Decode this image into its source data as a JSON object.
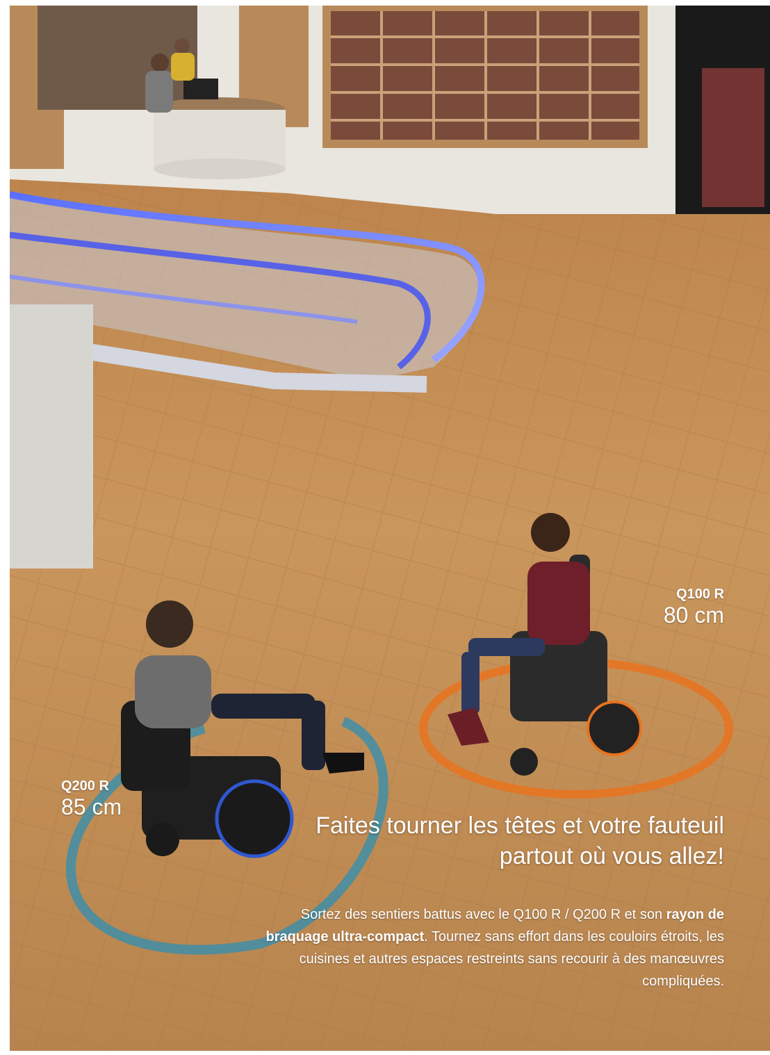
{
  "labels": {
    "q100_model": "Q100 R",
    "q100_distance": "80 cm",
    "q200_model": "Q200 R",
    "q200_distance": "85 cm"
  },
  "headline": {
    "line1": "Faites tourner les têtes et votre fauteuil",
    "line2": "partout où vous allez!"
  },
  "body": {
    "part1": "Sortez des sentiers battus avec le Q100 R / Q200 R et son",
    "emphasis": "rayon de braquage ultra-compact",
    "part2": ". Tournez sans effort dans les couloirs étroits, les cuisines et autres espaces restreints sans recourir à des manœuvres compliquées."
  },
  "colors": {
    "q100_circle": "#e8731f",
    "q200_circle": "#3f8ea8",
    "text": "#ffffff",
    "floor": "#c79256"
  }
}
